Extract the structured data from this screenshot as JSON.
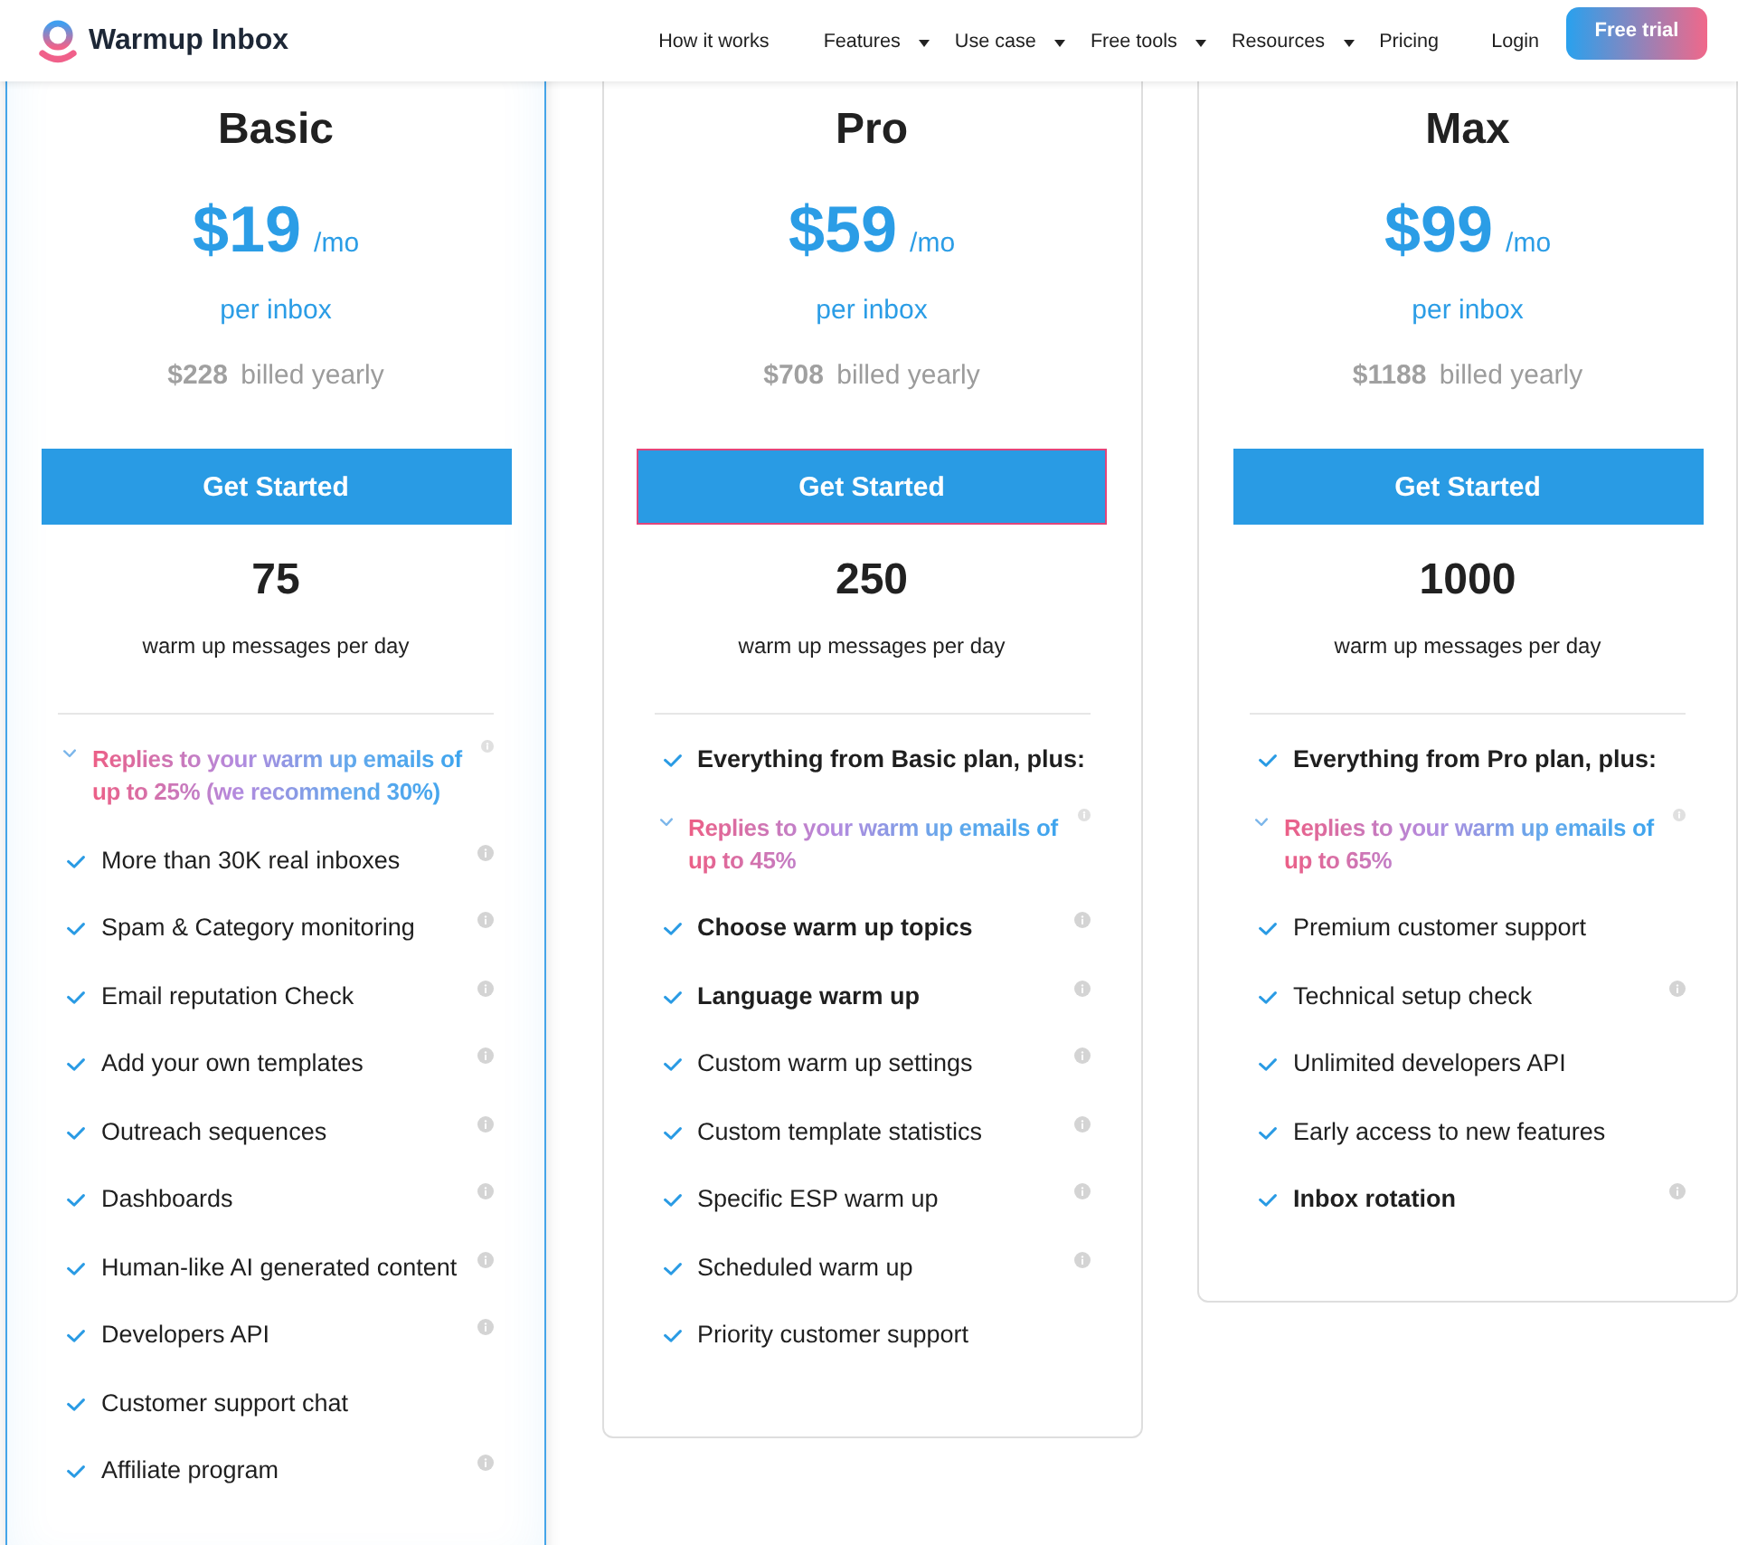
{
  "header": {
    "brand": "Warmup Inbox",
    "nav": [
      {
        "label": "How it works",
        "dropdown": false
      },
      {
        "label": "Features",
        "dropdown": true
      },
      {
        "label": "Use case",
        "dropdown": true
      },
      {
        "label": "Free tools",
        "dropdown": true
      },
      {
        "label": "Resources",
        "dropdown": true
      },
      {
        "label": "Pricing",
        "dropdown": false
      }
    ],
    "login": "Login",
    "cta": "Free trial"
  },
  "plans": [
    {
      "name": "Basic",
      "featured": true,
      "price": "$19",
      "period": "/mo",
      "unit": "per inbox",
      "billed": "**$228** billed yearly",
      "button": {
        "label": "Get Started",
        "focused": false
      },
      "messages": "75",
      "messages_label": "warm up messages per day",
      "features": [
        {
          "kind": "highlight",
          "text": "Replies to your warm up emails of up to 25% (we recommend 30%)",
          "bold": true,
          "info": true
        },
        {
          "kind": "plain",
          "text": "More than 30K real inboxes",
          "bold": false,
          "info": true
        },
        {
          "kind": "plain",
          "text": "Spam & Category monitoring",
          "bold": false,
          "info": true
        },
        {
          "kind": "plain",
          "text": "Email reputation Check",
          "bold": false,
          "info": true
        },
        {
          "kind": "plain",
          "text": "Add your own templates",
          "bold": false,
          "info": true
        },
        {
          "kind": "plain",
          "text": "Outreach sequences",
          "bold": false,
          "info": true
        },
        {
          "kind": "plain",
          "text": "Dashboards",
          "bold": false,
          "info": true
        },
        {
          "kind": "plain",
          "text": "Human-like AI generated content",
          "bold": false,
          "info": true
        },
        {
          "kind": "plain",
          "text": "Developers API",
          "bold": false,
          "info": true
        },
        {
          "kind": "plain",
          "text": "Customer support chat",
          "bold": false,
          "info": false
        },
        {
          "kind": "plain",
          "text": "Affiliate program",
          "bold": false,
          "info": true
        }
      ]
    },
    {
      "name": "Pro",
      "featured": false,
      "price": "$59",
      "period": "/mo",
      "unit": "per inbox",
      "billed": "**$708** billed yearly",
      "button": {
        "label": "Get Started",
        "focused": true
      },
      "messages": "250",
      "messages_label": "warm up messages per day",
      "features": [
        {
          "kind": "plain",
          "text": "Everything from Basic plan, plus:",
          "bold": true,
          "info": false
        },
        {
          "kind": "highlight",
          "text": "Replies to your warm up emails of up to 45%",
          "bold": true,
          "info": true
        },
        {
          "kind": "plain",
          "text": "Choose warm up topics",
          "bold": true,
          "info": true
        },
        {
          "kind": "plain",
          "text": "Language warm up",
          "bold": true,
          "info": true
        },
        {
          "kind": "plain",
          "text": "Custom warm up settings",
          "bold": false,
          "info": true
        },
        {
          "kind": "plain",
          "text": "Custom template statistics",
          "bold": false,
          "info": true
        },
        {
          "kind": "plain",
          "text": "Specific ESP warm up",
          "bold": false,
          "info": true
        },
        {
          "kind": "plain",
          "text": "Scheduled warm up",
          "bold": false,
          "info": true
        },
        {
          "kind": "plain",
          "text": "Priority customer support",
          "bold": false,
          "info": false
        }
      ]
    },
    {
      "name": "Max",
      "featured": false,
      "price": "$99",
      "period": "/mo",
      "unit": "per inbox",
      "billed": "**$1188** billed yearly",
      "button": {
        "label": "Get Started",
        "focused": false
      },
      "messages": "1000",
      "messages_label": "warm up messages per day",
      "features": [
        {
          "kind": "plain",
          "text": "Everything from Pro plan, plus:",
          "bold": true,
          "info": false
        },
        {
          "kind": "highlight",
          "text": "Replies to your warm up emails of up to 65%",
          "bold": true,
          "info": true
        },
        {
          "kind": "plain",
          "text": "Premium customer support",
          "bold": false,
          "info": false
        },
        {
          "kind": "plain",
          "text": "Technical setup check",
          "bold": false,
          "info": true
        },
        {
          "kind": "plain",
          "text": "Unlimited developers API",
          "bold": false,
          "info": false
        },
        {
          "kind": "plain",
          "text": "Early access to new features",
          "bold": false,
          "info": false
        },
        {
          "kind": "plain",
          "text": "Inbox rotation",
          "bold": true,
          "info": true
        }
      ]
    }
  ]
}
